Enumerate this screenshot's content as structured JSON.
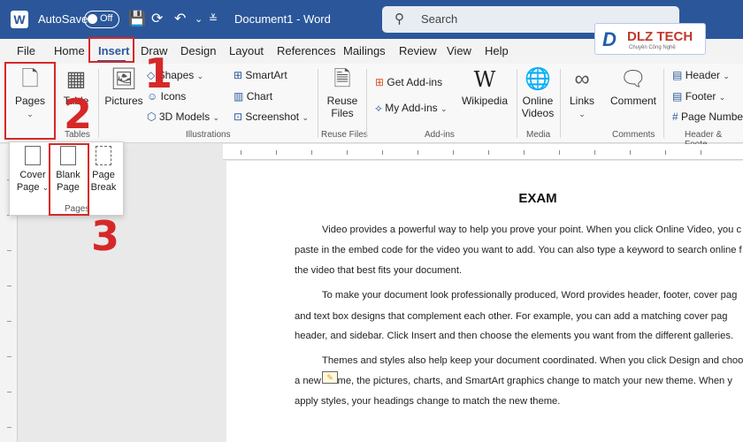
{
  "titlebar": {
    "app_logo_letter": "W",
    "autosave_label": "AutoSave",
    "autosave_state": "Off",
    "document_title": "Document1  -  Word",
    "search_placeholder": "Search"
  },
  "menu": {
    "tabs": [
      "File",
      "Home",
      "Insert",
      "Draw",
      "Design",
      "Layout",
      "References",
      "Mailings",
      "Review",
      "View",
      "Help"
    ],
    "active_tab": "Insert"
  },
  "ribbon": {
    "pages": "Pages",
    "tables_label": "Tables",
    "table": "Table",
    "pictures": "Pictures",
    "shapes": "Shapes",
    "icons": "Icons",
    "models3d": "3D Models",
    "smartart": "SmartArt",
    "chart": "Chart",
    "screenshot": "Screenshot",
    "illustrations_label": "Illustrations",
    "reuse_files": "Reuse Files",
    "reuse_files_label": "Reuse Files",
    "get_addins": "Get Add-ins",
    "my_addins": "My Add-ins",
    "wikipedia": "Wikipedia",
    "addins_label": "Add-ins",
    "online_videos": "Online Videos",
    "media_label": "Media",
    "links": "Links",
    "comment": "Comment",
    "comments_label": "Comments",
    "header": "Header",
    "footer": "Footer",
    "page_number": "Page Numbe",
    "header_footer_label": "Header & Foote"
  },
  "pages_dropdown": {
    "cover_page": "Cover Page",
    "blank_page": "Blank Page",
    "page_break": "Page Break",
    "group_label": "Pages"
  },
  "annotations": {
    "step1": "1",
    "step2": "2",
    "step3": "3"
  },
  "logo": {
    "mark": "D",
    "text": "DLZ TECH",
    "sub": "Chuyên Công Nghệ"
  },
  "document": {
    "title": "EXAM",
    "lines": [
      "Video provides a powerful way to help you prove your point. When you click Online Video, you c",
      "paste in the embed code for the video you want to add. You can also type a keyword to search online f",
      "the video that best fits your document.",
      "To make your document look professionally produced, Word provides header, footer, cover pag",
      "and text box designs that complement each other. For example, you can add a matching cover pag",
      "header, and sidebar. Click Insert and then choose the elements you want from the different galleries.",
      "Themes and styles also help keep your document coordinated. When you click Design and choo",
      "a new theme, the pictures, charts, and SmartArt graphics change to match your new theme. When y",
      "apply styles, your headings change to match the new theme."
    ]
  },
  "colors": {
    "accent": "#2b579a",
    "annotation_red": "#d62828"
  }
}
